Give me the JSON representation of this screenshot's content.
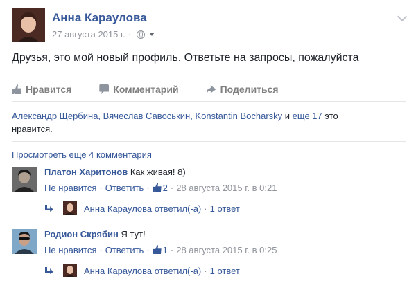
{
  "post": {
    "author": "Анна Караулова",
    "date": "27 августа 2015 г.",
    "separator": "·",
    "text": "Друзья, это мой новый профиль. Ответьте на запросы, пожалуйста",
    "actions": {
      "like": "Нравится",
      "comment": "Комментарий",
      "share": "Поделиться"
    },
    "likes": {
      "names": "Александр Щербина, Вячеслав Савоськин, Konstantin Bocharsky",
      "and": " и ",
      "others": "еще 17",
      "suffix": " это нравится."
    },
    "view_more": "Просмотреть еще 4 комментария"
  },
  "comments": [
    {
      "name": "Платон Харитонов",
      "text": "Как живая! 8)",
      "unlike": "Не нравится",
      "reply": "Ответить",
      "like_count": "2",
      "timestamp": "28 августа 2015 г. в 0:21",
      "reply_preview": {
        "author": "Анна Караулова",
        "verb": "ответил(-а)",
        "count": "1 ответ"
      }
    },
    {
      "name": "Родион Скрябин",
      "text": "Я тут!",
      "unlike": "Не нравится",
      "reply": "Ответить",
      "like_count": "1",
      "timestamp": "28 августа 2015 г. в 0:25",
      "reply_preview": {
        "author": "Анна Караулова",
        "verb": "ответил(-а)",
        "count": "1 ответ"
      }
    }
  ],
  "colors": {
    "link": "#365899",
    "muted": "#90949c",
    "text": "#1d2129"
  },
  "icons": [
    "globe-icon",
    "caret-down-icon",
    "chevron-down-icon",
    "like-icon",
    "comment-icon",
    "share-icon",
    "thumb-up-icon",
    "reply-arrow-icon"
  ]
}
